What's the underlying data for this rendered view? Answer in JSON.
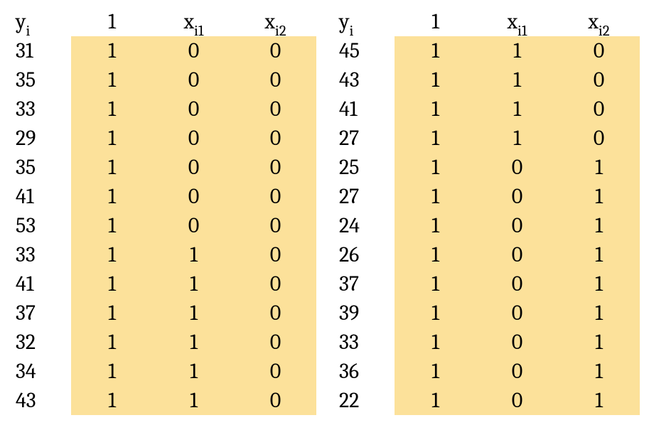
{
  "headers": {
    "y": "y",
    "y_sub": "i",
    "c1": "1",
    "x1": "x",
    "x1_sub": "i1",
    "x2": "x",
    "x2_sub": "i2"
  },
  "left": {
    "y": [
      "31",
      "35",
      "33",
      "29",
      "35",
      "41",
      "53",
      "33",
      "41",
      "37",
      "32",
      "34",
      "43"
    ],
    "c1": [
      "1",
      "1",
      "1",
      "1",
      "1",
      "1",
      "1",
      "1",
      "1",
      "1",
      "1",
      "1",
      "1"
    ],
    "xi1": [
      "0",
      "0",
      "0",
      "0",
      "0",
      "0",
      "0",
      "1",
      "1",
      "1",
      "1",
      "1",
      "1"
    ],
    "xi2": [
      "0",
      "0",
      "0",
      "0",
      "0",
      "0",
      "0",
      "0",
      "0",
      "0",
      "0",
      "0",
      "0"
    ]
  },
  "right": {
    "y": [
      "45",
      "43",
      "41",
      "27",
      "25",
      "27",
      "24",
      "26",
      "37",
      "39",
      "33",
      "36",
      "22"
    ],
    "c1": [
      "1",
      "1",
      "1",
      "1",
      "1",
      "1",
      "1",
      "1",
      "1",
      "1",
      "1",
      "1",
      "1"
    ],
    "xi1": [
      "1",
      "1",
      "1",
      "1",
      "0",
      "0",
      "0",
      "0",
      "0",
      "0",
      "0",
      "0",
      "0"
    ],
    "xi2": [
      "0",
      "0",
      "0",
      "0",
      "1",
      "1",
      "1",
      "1",
      "1",
      "1",
      "1",
      "1",
      "1"
    ]
  },
  "chart_data": {
    "type": "table",
    "title": "",
    "columns": [
      "y_i",
      "1",
      "x_i1",
      "x_i2"
    ],
    "rows": [
      [
        31,
        1,
        0,
        0
      ],
      [
        35,
        1,
        0,
        0
      ],
      [
        33,
        1,
        0,
        0
      ],
      [
        29,
        1,
        0,
        0
      ],
      [
        35,
        1,
        0,
        0
      ],
      [
        41,
        1,
        0,
        0
      ],
      [
        53,
        1,
        0,
        0
      ],
      [
        33,
        1,
        1,
        0
      ],
      [
        41,
        1,
        1,
        0
      ],
      [
        37,
        1,
        1,
        0
      ],
      [
        32,
        1,
        1,
        0
      ],
      [
        34,
        1,
        1,
        0
      ],
      [
        43,
        1,
        1,
        0
      ],
      [
        45,
        1,
        1,
        0
      ],
      [
        43,
        1,
        1,
        0
      ],
      [
        41,
        1,
        1,
        0
      ],
      [
        27,
        1,
        1,
        0
      ],
      [
        25,
        1,
        0,
        1
      ],
      [
        27,
        1,
        0,
        1
      ],
      [
        24,
        1,
        0,
        1
      ],
      [
        26,
        1,
        0,
        1
      ],
      [
        37,
        1,
        0,
        1
      ],
      [
        39,
        1,
        0,
        1
      ],
      [
        33,
        1,
        0,
        1
      ],
      [
        36,
        1,
        0,
        1
      ],
      [
        22,
        1,
        0,
        1
      ]
    ]
  }
}
